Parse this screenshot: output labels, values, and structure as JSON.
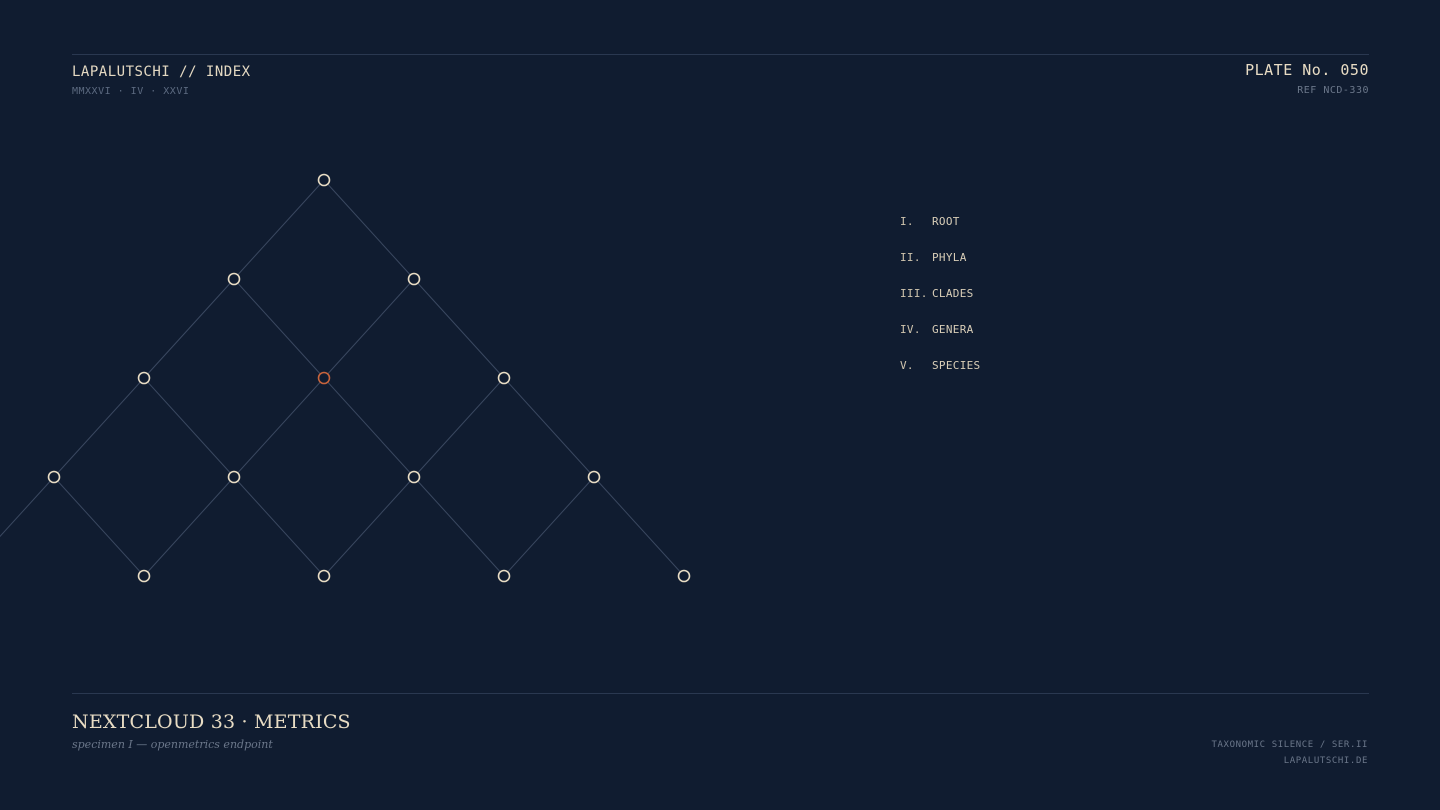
{
  "header": {
    "title": "LAPALUTSCHI // INDEX",
    "date": "MMXXVI · IV · XXVI",
    "plate": "PLATE No. 050",
    "ref": "REF NCD-330"
  },
  "legend": [
    {
      "numeral": "I.",
      "label": "ROOT"
    },
    {
      "numeral": "II.",
      "label": "PHYLA"
    },
    {
      "numeral": "III.",
      "label": "CLADES"
    },
    {
      "numeral": "IV.",
      "label": "GENERA"
    },
    {
      "numeral": "V.",
      "label": "SPECIES"
    }
  ],
  "diagram": {
    "levels": [
      {
        "slots": [
          2
        ],
        "highlight": []
      },
      {
        "slots": [
          1.5,
          2.5
        ],
        "highlight": []
      },
      {
        "slots": [
          1,
          2,
          3
        ],
        "highlight": [
          2
        ]
      },
      {
        "slots": [
          0.5,
          1.5,
          2.5,
          3.5
        ],
        "highlight": []
      },
      {
        "slots": [
          1,
          2,
          3,
          4
        ],
        "highlight": []
      }
    ],
    "colors": {
      "node": "#e8dcc4",
      "highlight": "#c8643c",
      "edge": "#3a4860"
    }
  },
  "footer": {
    "title": "NEXTCLOUD 33 · METRICS",
    "subtitle": "specimen I — openmetrics endpoint",
    "series": "TAXONOMIC SILENCE / SER.II",
    "site": "LAPALUTSCHI.DE"
  }
}
